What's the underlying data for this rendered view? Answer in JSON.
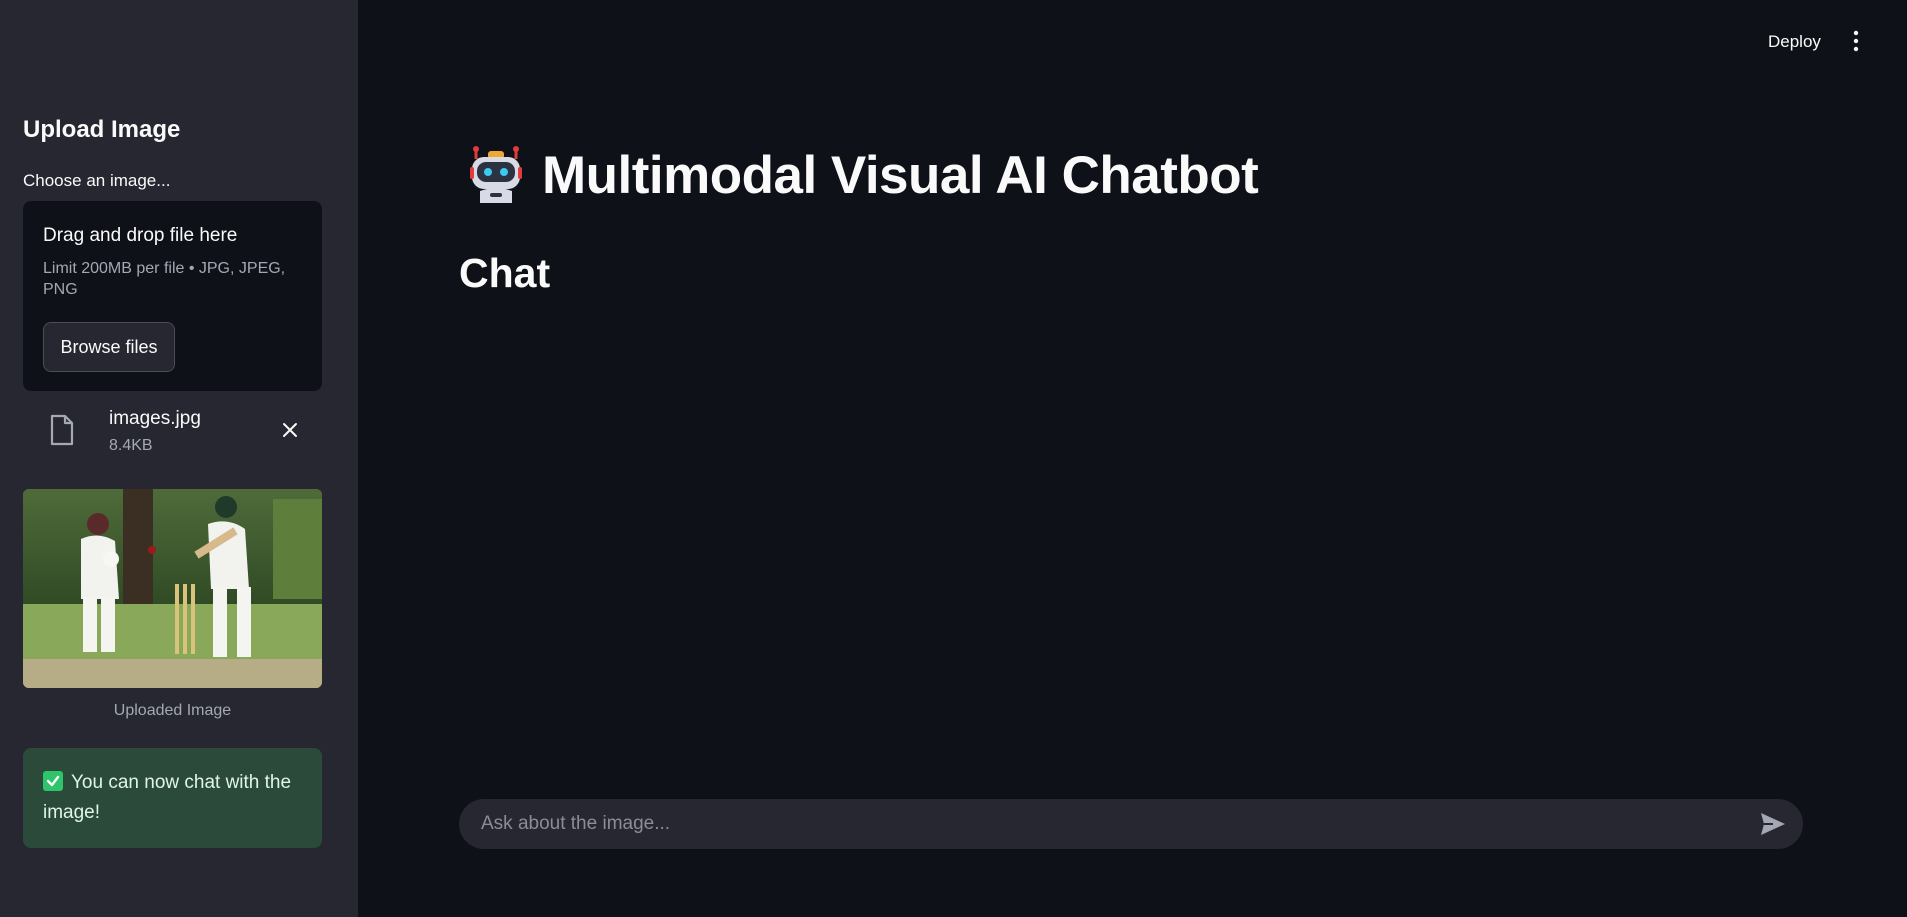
{
  "header": {
    "deploy_label": "Deploy",
    "menu_icon": "kebab-menu-icon"
  },
  "sidebar": {
    "title": "Upload Image",
    "uploader_label": "Choose an image...",
    "dropzone": {
      "title": "Drag and drop file here",
      "limit_text": "Limit 200MB per file • JPG, JPEG, PNG",
      "browse_label": "Browse files"
    },
    "file": {
      "name": "images.jpg",
      "size": "8.4KB",
      "icon": "file-icon",
      "remove_icon": "close-icon"
    },
    "preview_caption": "Uploaded Image",
    "success_message": "You can now chat with the image!"
  },
  "main": {
    "title": "Multimodal Visual AI Chatbot",
    "title_icon": "robot-icon",
    "chat_heading": "Chat",
    "chat_input_placeholder": "Ask about the image...",
    "send_icon": "send-icon"
  },
  "colors": {
    "background": "#0e1117",
    "sidebar": "#262730",
    "success_bg": "#2b4a3a",
    "text": "#fafafa"
  }
}
